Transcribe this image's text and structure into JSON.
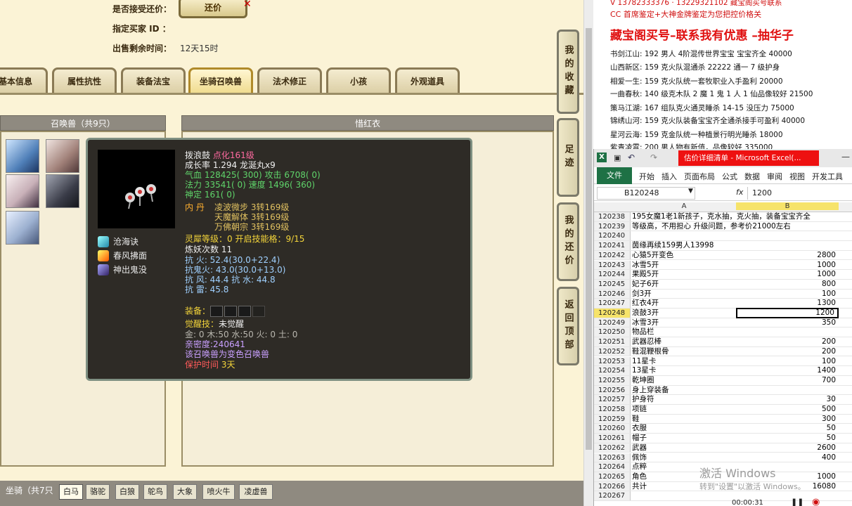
{
  "game": {
    "accept_counter_label": "是否接受还价：",
    "counter_button": "还价",
    "designated_buyer_label": "指定买家 ID ：",
    "designated_buyer_value": "",
    "remaining_time_label": "出售剩余时间：",
    "remaining_time_value": "12天15时",
    "tabs": [
      "基本信息",
      "属性抗性",
      "装备法宝",
      "坐骑召唤兽",
      "法术修正",
      "小孩",
      "外观道具"
    ],
    "summons_header": "召唤兽（共9只）",
    "detail_header": "惜红衣",
    "side_buttons": [
      "我的收藏",
      "足迹",
      "我的还价",
      "返回顶部"
    ],
    "mount_header": "坐骑（共7只",
    "mount_tabs": [
      "白马",
      "骆驼",
      "白狼",
      "鸵鸟",
      "大象",
      "喷火牛",
      "凌虚兽"
    ]
  },
  "tooltip": {
    "name": "拨浪鼓",
    "name_suffix": "点化161级",
    "growth": "成长率 1.294 龙涎丸x9",
    "hp_attack": "气血 128425( 300) 攻击 6708( 0)",
    "mana_speed": "法力 33541( 0) 速度 1496( 360)",
    "spirit": "神定 161( 0)",
    "inner_label": "内    丹",
    "inner_1": "凌波微步 3转169级",
    "inner_2": "天魔解体 3转169级",
    "inner_3": "万佛朝宗 3转169级",
    "spirit_level": "灵犀等级：0 开启技能格：9/15",
    "refine_count": "炼妖次数 11",
    "resist_fire": "抗    火: 52.4(30.0+22.4)",
    "resist_ghost": "抗鬼火: 43.0(30.0+13.0)",
    "resist_wind_water": "抗    风: 44.4 抗    水: 44.8",
    "resist_thunder": "抗    雷: 45.8",
    "equip_label": "装备：",
    "awaken_label": "觉醒技：",
    "awaken_value": "未觉醒",
    "elements": "金: 0 木:50 水:50 火: 0 土: 0",
    "intimacy": "亲密度:240641",
    "variant_note": "该召唤兽为变色召唤兽",
    "protect_label": "保护时间",
    "protect_value": "3天",
    "skills": [
      "沧海诀",
      "春风拂面",
      "神出鬼没"
    ]
  },
  "overlay": {
    "line_top": "V 13782333376 · 13229321102 藏宝阁买号联系",
    "line_cc": "CC 首席鉴定+大神金牌鉴定为您把控价格关",
    "headline": "藏宝阁买号–联系我有优惠 –抽华子",
    "listings": [
      "书剑江山: 192 男人 4阶混传世界宝宝 宝宝齐全 40000",
      "山西新区: 159 克火队混通杀 22222 通一 7 级护身",
      "相爱一生: 159 克火队统一套牧职业入手盈利 20000",
      "一曲春秋: 140 级克木队 2 魔 1 鬼 1 人 1 仙品像较好 21500",
      "策马江湖: 167 组队克火通灵睡杀 14-15 没压力 75000",
      "锦绣山河: 159 克火队装备宝宝齐全通杀接手可盈利 40000",
      "星河云海: 159 克金队统一种植景行明光睡杀 18000",
      "紫青凌霄: 200 男人物有新值，品像较好 335000"
    ]
  },
  "excel": {
    "title": "估价详细清单 - Microsoft Excel(...",
    "ribbon": [
      "文件",
      "开始",
      "插入",
      "页面布局",
      "公式",
      "数据",
      "审阅",
      "视图",
      "开发工具"
    ],
    "name_box": "B120248",
    "fx": "fx",
    "formula_value": "1200",
    "col_a": "A",
    "col_b": "B",
    "rows": [
      {
        "n": "120238",
        "a": "195女魔1老1新孩子，克水抽，克火抽，装备宝宝齐全",
        "b": ""
      },
      {
        "n": "120239",
        "a": "等级高，不用担心 升级问题，参考价21000左右",
        "b": ""
      },
      {
        "n": "120240",
        "a": "",
        "b": ""
      },
      {
        "n": "120241",
        "a": "茵缘再续159男人13998",
        "b": ""
      },
      {
        "n": "120242",
        "a": "心猿5开变色",
        "b": "2800"
      },
      {
        "n": "120243",
        "a": "冰雪5开",
        "b": "1000"
      },
      {
        "n": "120244",
        "a": "果殿5开",
        "b": "1000"
      },
      {
        "n": "120245",
        "a": "妃子6开",
        "b": "800"
      },
      {
        "n": "120246",
        "a": "剑3开",
        "b": "100"
      },
      {
        "n": "120247",
        "a": "红衣4开",
        "b": "1300"
      },
      {
        "n": "120248",
        "a": "浪鼓3开",
        "b": "1200"
      },
      {
        "n": "120249",
        "a": "冰雪3开",
        "b": "350"
      },
      {
        "n": "120250",
        "a": "物品栏",
        "b": ""
      },
      {
        "n": "120251",
        "a": "武器忍棒",
        "b": "200"
      },
      {
        "n": "120252",
        "a": "鞋混鞭根骨",
        "b": "200"
      },
      {
        "n": "120253",
        "a": "11星卡",
        "b": "100"
      },
      {
        "n": "120254",
        "a": "13星卡",
        "b": "1400"
      },
      {
        "n": "120255",
        "a": "乾坤圈",
        "b": "700"
      },
      {
        "n": "120256",
        "a": "身上穿装备",
        "b": ""
      },
      {
        "n": "120257",
        "a": "护身符",
        "b": "30"
      },
      {
        "n": "120258",
        "a": "项链",
        "b": "500"
      },
      {
        "n": "120259",
        "a": "鞋",
        "b": "300"
      },
      {
        "n": "120260",
        "a": "衣服",
        "b": "50"
      },
      {
        "n": "120261",
        "a": "帽子",
        "b": "50"
      },
      {
        "n": "120262",
        "a": "武器",
        "b": "2600"
      },
      {
        "n": "120263",
        "a": "佩饰",
        "b": "400"
      },
      {
        "n": "120264",
        "a": "点粹",
        "b": ""
      },
      {
        "n": "120265",
        "a": "角色",
        "b": "1000"
      },
      {
        "n": "120266",
        "a": "共计",
        "b": "16080"
      },
      {
        "n": "120267",
        "a": "",
        "b": ""
      }
    ],
    "selected_row": "120248",
    "watermark_title": "激活 Windows",
    "watermark_sub": "转到\"设置\"以激活 Windows。",
    "recording_time": "00:00:31"
  }
}
